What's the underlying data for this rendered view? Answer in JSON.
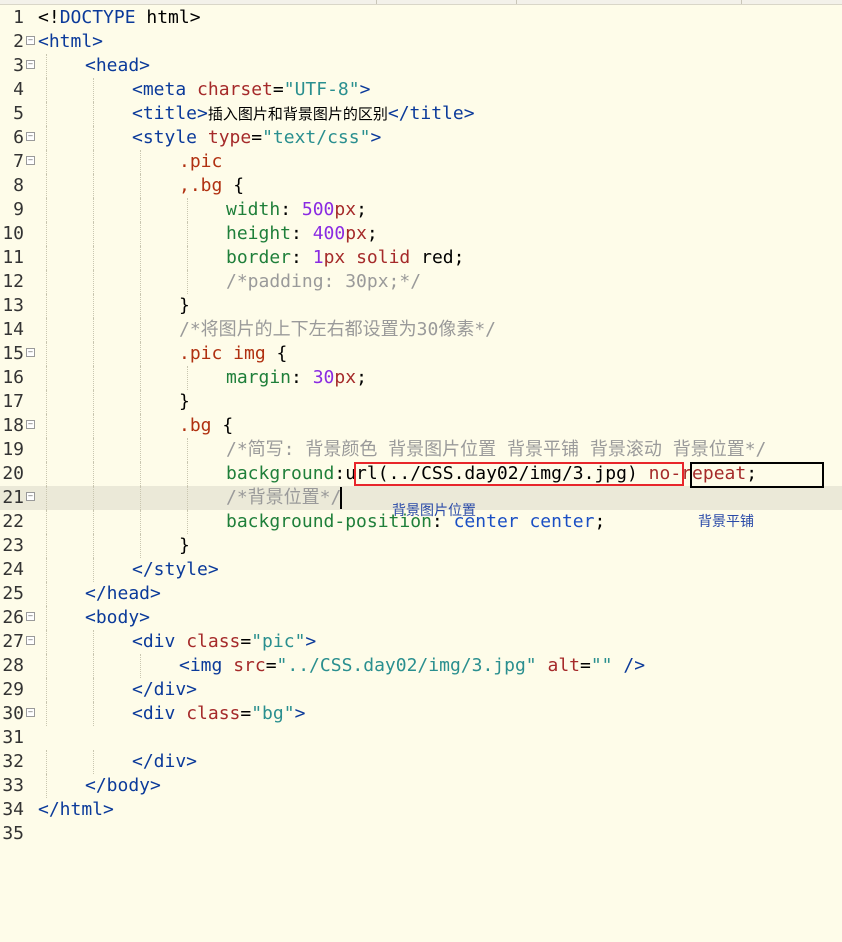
{
  "editor": {
    "lines": [
      {
        "n": "1",
        "fold": false,
        "indent": 0,
        "tokens": [
          [
            "punc",
            "<!"
          ],
          [
            "tag",
            "DOCTYPE"
          ],
          [
            "punc",
            " html>"
          ]
        ]
      },
      {
        "n": "2",
        "fold": true,
        "indent": 0,
        "tokens": [
          [
            "tag",
            "<html>"
          ]
        ]
      },
      {
        "n": "3",
        "fold": true,
        "indent": 1,
        "tokens": [
          [
            "tag",
            "<head>"
          ]
        ]
      },
      {
        "n": "4",
        "fold": false,
        "indent": 2,
        "tokens": [
          [
            "tag",
            "<meta "
          ],
          [
            "attr",
            "charset"
          ],
          [
            "punc",
            "="
          ],
          [
            "str",
            "\"UTF-8\""
          ],
          [
            "tag",
            ">"
          ]
        ]
      },
      {
        "n": "5",
        "fold": false,
        "indent": 2,
        "tokens": [
          [
            "tag",
            "<title>"
          ],
          [
            "cjk",
            "插入图片和背景图片的区别"
          ],
          [
            "tag",
            "</title>"
          ]
        ]
      },
      {
        "n": "6",
        "fold": true,
        "indent": 2,
        "tokens": [
          [
            "tag",
            "<style "
          ],
          [
            "attr",
            "type"
          ],
          [
            "punc",
            "="
          ],
          [
            "str",
            "\"text/css\""
          ],
          [
            "tag",
            ">"
          ]
        ]
      },
      {
        "n": "7",
        "fold": true,
        "indent": 3,
        "tokens": [
          [
            "sel",
            ".pic"
          ]
        ]
      },
      {
        "n": "8",
        "fold": false,
        "indent": 3,
        "tokens": [
          [
            "sel",
            ",.bg "
          ],
          [
            "punc",
            "{"
          ]
        ]
      },
      {
        "n": "9",
        "fold": false,
        "indent": 4,
        "tokens": [
          [
            "prop",
            "width"
          ],
          [
            "punc",
            ": "
          ],
          [
            "num",
            "500"
          ],
          [
            "kw",
            "px"
          ],
          [
            "punc",
            ";"
          ]
        ]
      },
      {
        "n": "10",
        "fold": false,
        "indent": 4,
        "tokens": [
          [
            "prop",
            "height"
          ],
          [
            "punc",
            ": "
          ],
          [
            "num",
            "400"
          ],
          [
            "kw",
            "px"
          ],
          [
            "punc",
            ";"
          ]
        ]
      },
      {
        "n": "11",
        "fold": false,
        "indent": 4,
        "tokens": [
          [
            "prop",
            "border"
          ],
          [
            "punc",
            ": "
          ],
          [
            "num",
            "1"
          ],
          [
            "kw",
            "px solid "
          ],
          [
            "punc",
            "red;"
          ]
        ]
      },
      {
        "n": "12",
        "fold": false,
        "indent": 4,
        "tokens": [
          [
            "com",
            "/*padding: 30px;*/"
          ]
        ]
      },
      {
        "n": "13",
        "fold": false,
        "indent": 3,
        "tokens": [
          [
            "punc",
            "}"
          ]
        ]
      },
      {
        "n": "14",
        "fold": false,
        "indent": 3,
        "tokens": [
          [
            "com",
            "/*将图片的上下左右都设置为30像素*/"
          ]
        ]
      },
      {
        "n": "15",
        "fold": true,
        "indent": 3,
        "tokens": [
          [
            "sel",
            ".pic img "
          ],
          [
            "punc",
            "{"
          ]
        ]
      },
      {
        "n": "16",
        "fold": false,
        "indent": 4,
        "tokens": [
          [
            "prop",
            "margin"
          ],
          [
            "punc",
            ": "
          ],
          [
            "num",
            "30"
          ],
          [
            "kw",
            "px"
          ],
          [
            "punc",
            ";"
          ]
        ]
      },
      {
        "n": "17",
        "fold": false,
        "indent": 3,
        "tokens": [
          [
            "punc",
            "}"
          ]
        ]
      },
      {
        "n": "18",
        "fold": true,
        "indent": 3,
        "tokens": [
          [
            "sel",
            ".bg "
          ],
          [
            "punc",
            "{"
          ]
        ]
      },
      {
        "n": "19",
        "fold": false,
        "indent": 4,
        "tokens": [
          [
            "com",
            "/*简写: 背景颜色 背景图片位置 背景平铺 背景滚动 背景位置*/"
          ]
        ]
      },
      {
        "n": "20",
        "fold": false,
        "indent": 4,
        "tokens": [
          [
            "prop",
            "background"
          ],
          [
            "punc",
            ":"
          ],
          [
            "punc",
            "url(../CSS.day02/img/3.jpg)"
          ],
          [
            "punc",
            " "
          ],
          [
            "kw",
            "no-repeat"
          ],
          [
            "punc",
            ";"
          ]
        ]
      },
      {
        "n": "21",
        "fold": true,
        "indent": 4,
        "tokens": [
          [
            "com",
            "/*背景位置*/"
          ]
        ]
      },
      {
        "n": "22",
        "fold": false,
        "indent": 4,
        "tokens": [
          [
            "prop",
            "background-position"
          ],
          [
            "punc",
            ": "
          ],
          [
            "val",
            "center center"
          ],
          [
            "punc",
            ";"
          ]
        ]
      },
      {
        "n": "23",
        "fold": false,
        "indent": 3,
        "tokens": [
          [
            "punc",
            "}"
          ]
        ]
      },
      {
        "n": "24",
        "fold": false,
        "indent": 2,
        "tokens": [
          [
            "tag",
            "</style>"
          ]
        ]
      },
      {
        "n": "25",
        "fold": false,
        "indent": 1,
        "tokens": [
          [
            "tag",
            "</head>"
          ]
        ]
      },
      {
        "n": "26",
        "fold": true,
        "indent": 1,
        "tokens": [
          [
            "tag",
            "<body>"
          ]
        ]
      },
      {
        "n": "27",
        "fold": true,
        "indent": 2,
        "tokens": [
          [
            "tag",
            "<div "
          ],
          [
            "attr",
            "class"
          ],
          [
            "punc",
            "="
          ],
          [
            "str",
            "\"pic\""
          ],
          [
            "tag",
            ">"
          ]
        ]
      },
      {
        "n": "28",
        "fold": false,
        "indent": 3,
        "tokens": [
          [
            "tag",
            "<img "
          ],
          [
            "attr",
            "src"
          ],
          [
            "punc",
            "="
          ],
          [
            "str",
            "\"../CSS.day02/img/3.jpg\""
          ],
          [
            "punc",
            " "
          ],
          [
            "attr",
            "alt"
          ],
          [
            "punc",
            "="
          ],
          [
            "str",
            "\"\""
          ],
          [
            "tag",
            " />"
          ]
        ]
      },
      {
        "n": "29",
        "fold": false,
        "indent": 2,
        "tokens": [
          [
            "tag",
            "</div>"
          ]
        ]
      },
      {
        "n": "30",
        "fold": true,
        "indent": 2,
        "tokens": [
          [
            "tag",
            "<div "
          ],
          [
            "attr",
            "class"
          ],
          [
            "punc",
            "="
          ],
          [
            "str",
            "\"bg\""
          ],
          [
            "tag",
            ">"
          ]
        ]
      },
      {
        "n": "31",
        "fold": false,
        "indent": 0,
        "tokens": []
      },
      {
        "n": "32",
        "fold": false,
        "indent": 2,
        "tokens": [
          [
            "tag",
            "</div>"
          ]
        ]
      },
      {
        "n": "33",
        "fold": false,
        "indent": 1,
        "tokens": [
          [
            "tag",
            "</body>"
          ]
        ]
      },
      {
        "n": "34",
        "fold": false,
        "indent": 0,
        "tokens": [
          [
            "tag",
            "</html>"
          ]
        ]
      },
      {
        "n": "35",
        "fold": false,
        "indent": 0,
        "tokens": []
      }
    ],
    "current_line": "21",
    "fold_glyph": "−"
  },
  "annotations": {
    "red_box_label": "背景图片位置",
    "black_box_label": "背景平铺",
    "red_color": "#e8262b",
    "black_color": "#000000"
  }
}
